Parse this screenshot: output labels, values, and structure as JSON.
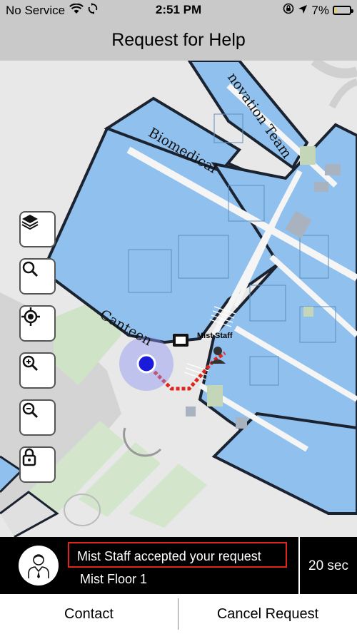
{
  "status_bar": {
    "carrier": "No Service",
    "time": "2:51 PM",
    "battery_percent": "7%",
    "battery_level": 0.07,
    "icons": [
      "wifi-icon",
      "sync-icon",
      "orientation-lock-icon",
      "location-arrow-icon",
      "battery-charging-icon"
    ]
  },
  "header": {
    "title": "Request for Help"
  },
  "map": {
    "labels": {
      "innovation": "novation Team",
      "biomedical": "Biomedical",
      "canteen": "Canteen"
    },
    "staff_label": "Mist Staff",
    "colors": {
      "building": "#8fc0ee",
      "outline": "#1c2330",
      "route": "#e0261b",
      "user_dot": "#1a1adb",
      "grass": "#cfe3c6"
    }
  },
  "map_controls": [
    {
      "name": "layers",
      "icon": "layers-icon"
    },
    {
      "name": "search",
      "icon": "search-icon"
    },
    {
      "name": "locate",
      "icon": "locate-icon"
    },
    {
      "name": "zoom-in",
      "icon": "zoom-in-icon"
    },
    {
      "name": "zoom-out",
      "icon": "zoom-out-icon"
    },
    {
      "name": "lock",
      "icon": "lock-icon"
    }
  ],
  "banner": {
    "message": "Mist Staff accepted your request",
    "floor": "Mist Floor 1",
    "timer": "20 sec",
    "avatar_icon": "staff-avatar-icon",
    "highlight_color": "#e0261b"
  },
  "actions": {
    "contact": "Contact",
    "cancel": "Cancel Request"
  }
}
